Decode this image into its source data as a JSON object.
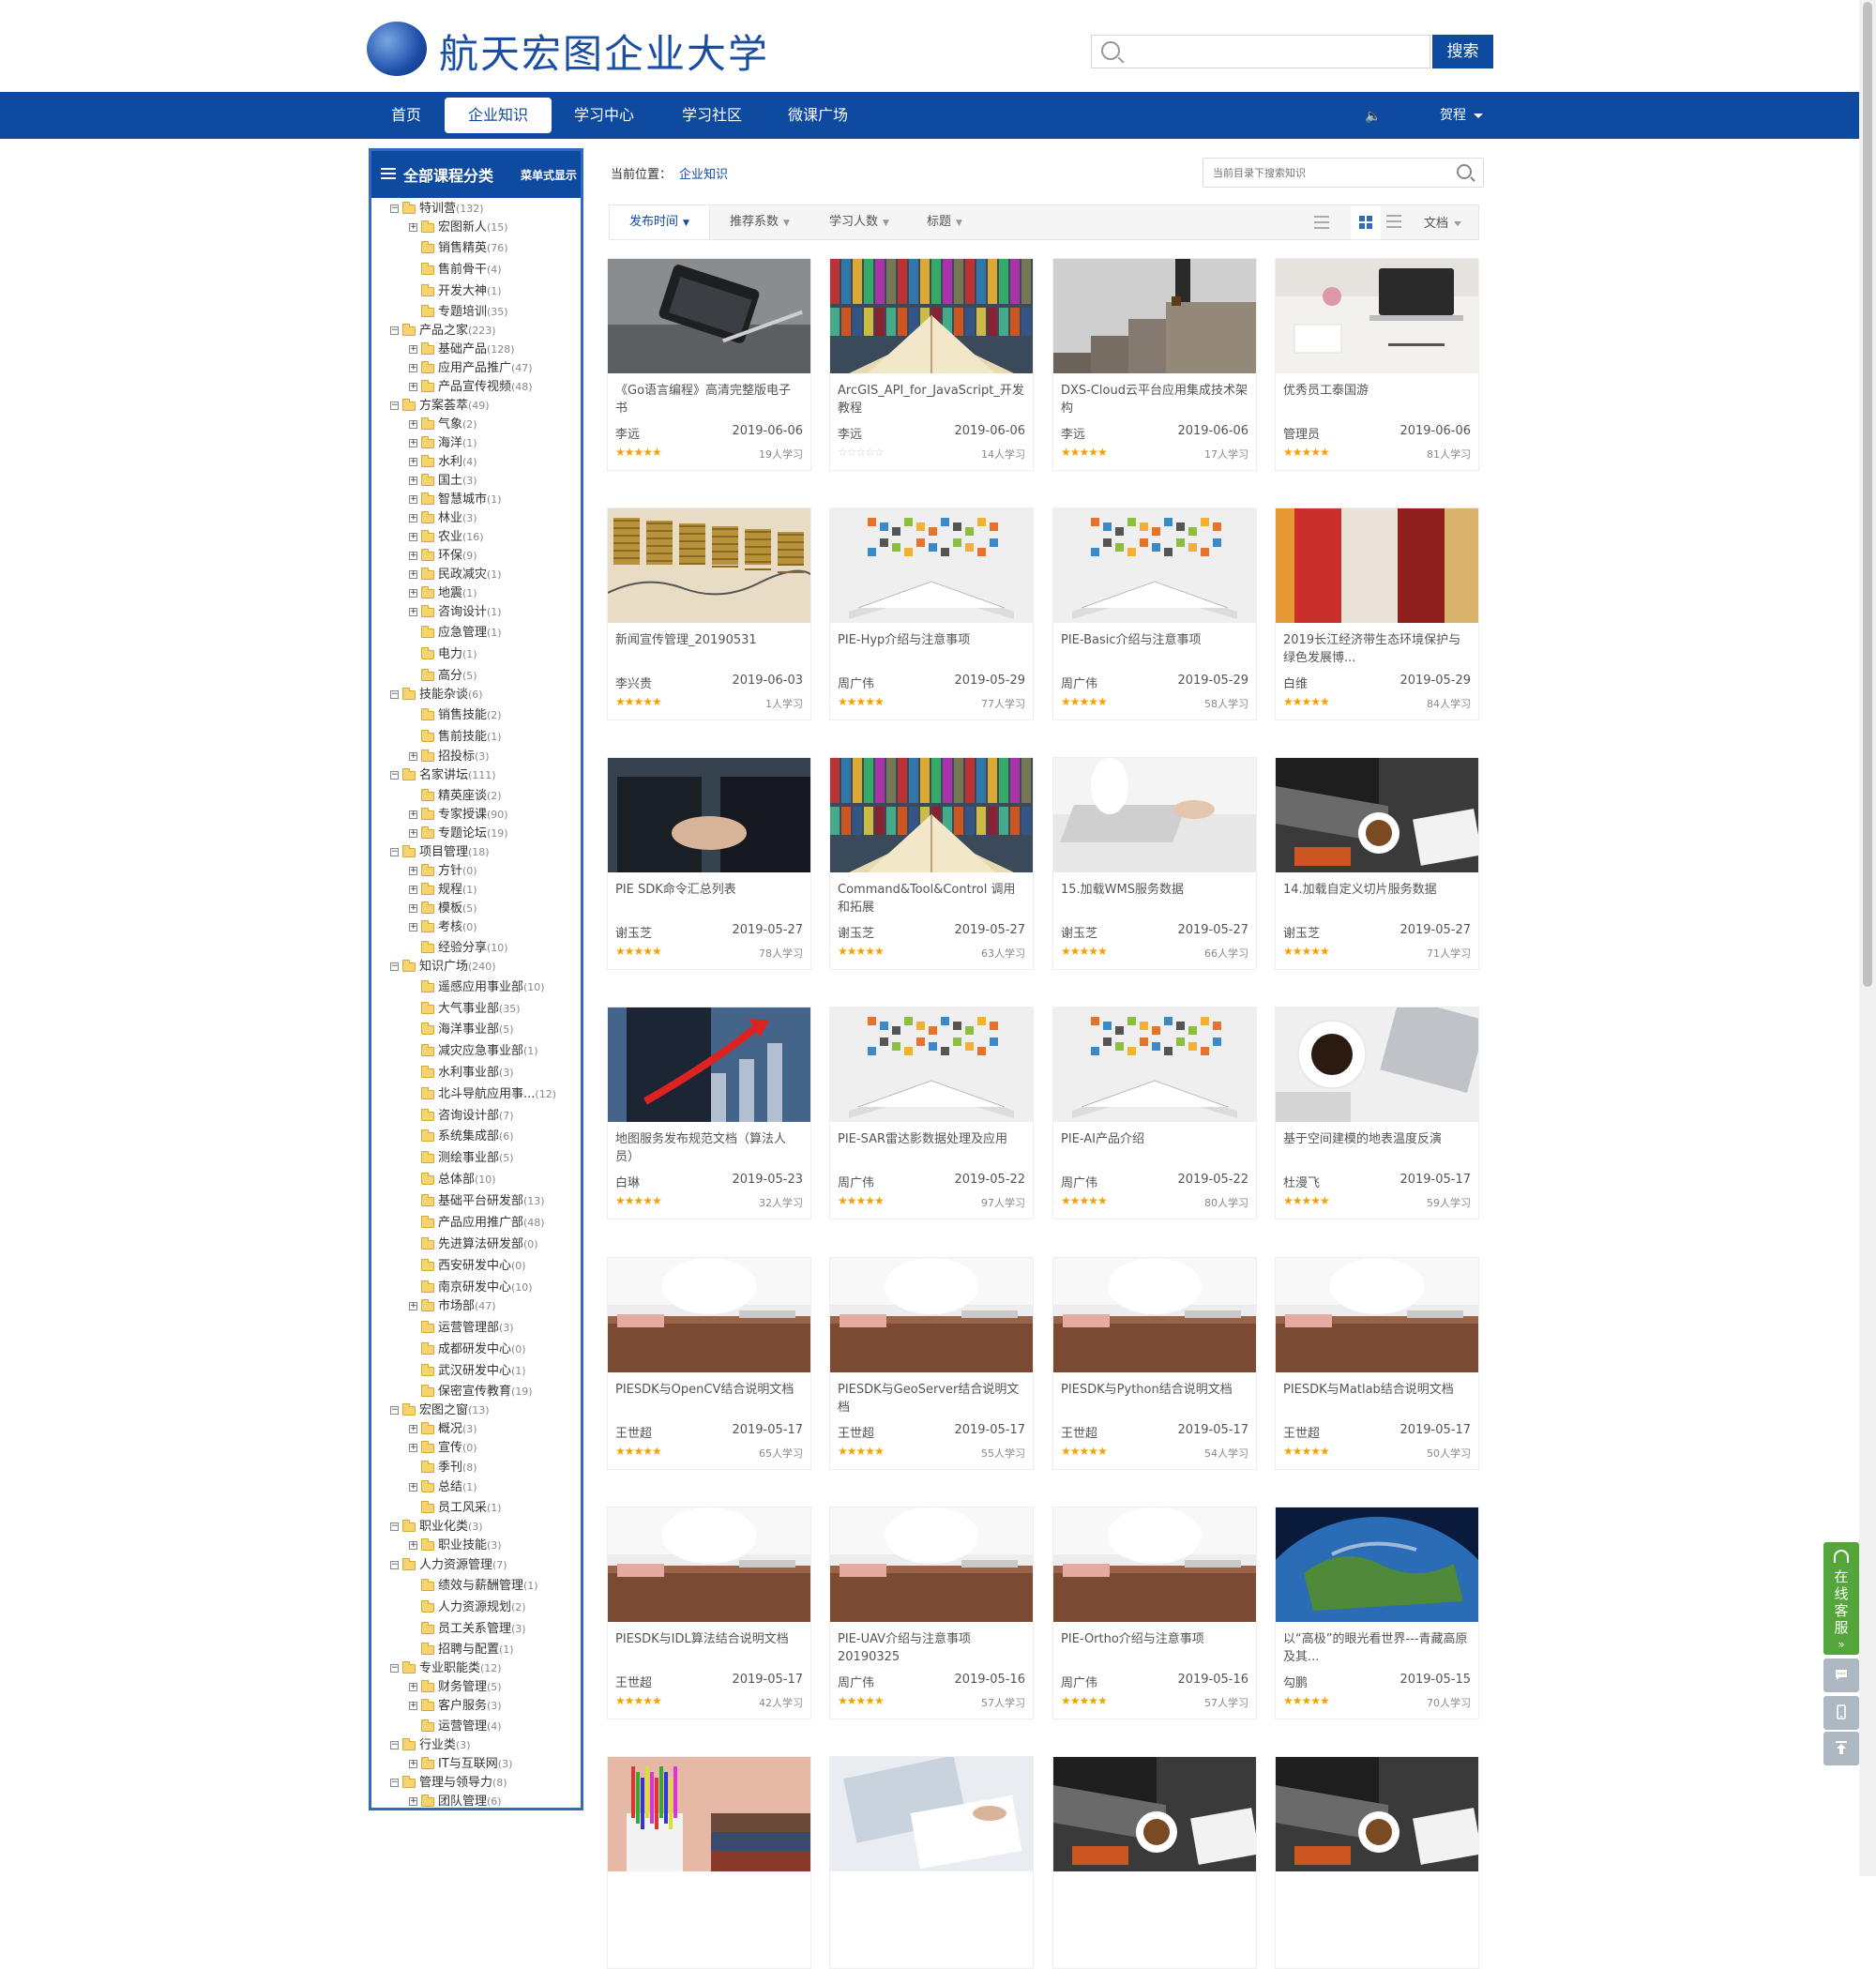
{
  "header": {
    "logo_text": "航天宏图企业大学",
    "search_placeholder": "",
    "search_button": "搜索"
  },
  "nav": {
    "items": [
      {
        "label": "首页",
        "active": false
      },
      {
        "label": "企业知识",
        "active": true
      },
      {
        "label": "学习中心",
        "active": false
      },
      {
        "label": "学习社区",
        "active": false
      },
      {
        "label": "微课广场",
        "active": false
      }
    ],
    "speaker_icon": "speaker-icon",
    "user_name": "贺程"
  },
  "sidebar": {
    "title": "全部课程分类",
    "mode_label": "菜单式显示",
    "tree": [
      {
        "level": 0,
        "toggle": "-",
        "label": "特训营",
        "count": "(132)"
      },
      {
        "level": 1,
        "toggle": "+",
        "label": "宏图新人",
        "count": "(15)"
      },
      {
        "level": 1,
        "toggle": "",
        "label": "销售精英",
        "count": "(76)"
      },
      {
        "level": 1,
        "toggle": "",
        "label": "售前骨干",
        "count": "(4)"
      },
      {
        "level": 1,
        "toggle": "",
        "label": "开发大神",
        "count": "(1)"
      },
      {
        "level": 1,
        "toggle": "",
        "label": "专题培训",
        "count": "(35)"
      },
      {
        "level": 0,
        "toggle": "-",
        "label": "产品之家",
        "count": "(223)"
      },
      {
        "level": 1,
        "toggle": "+",
        "label": "基础产品",
        "count": "(128)"
      },
      {
        "level": 1,
        "toggle": "+",
        "label": "应用产品推广",
        "count": "(47)"
      },
      {
        "level": 1,
        "toggle": "+",
        "label": "产品宣传视频",
        "count": "(48)"
      },
      {
        "level": 0,
        "toggle": "-",
        "label": "方案荟萃",
        "count": "(49)"
      },
      {
        "level": 1,
        "toggle": "+",
        "label": "气象",
        "count": "(2)"
      },
      {
        "level": 1,
        "toggle": "+",
        "label": "海洋",
        "count": "(1)"
      },
      {
        "level": 1,
        "toggle": "+",
        "label": "水利",
        "count": "(4)"
      },
      {
        "level": 1,
        "toggle": "+",
        "label": "国土",
        "count": "(3)"
      },
      {
        "level": 1,
        "toggle": "+",
        "label": "智慧城市",
        "count": "(1)"
      },
      {
        "level": 1,
        "toggle": "+",
        "label": "林业",
        "count": "(3)"
      },
      {
        "level": 1,
        "toggle": "+",
        "label": "农业",
        "count": "(16)"
      },
      {
        "level": 1,
        "toggle": "+",
        "label": "环保",
        "count": "(9)"
      },
      {
        "level": 1,
        "toggle": "+",
        "label": "民政减灾",
        "count": "(1)"
      },
      {
        "level": 1,
        "toggle": "+",
        "label": "地震",
        "count": "(1)"
      },
      {
        "level": 1,
        "toggle": "+",
        "label": "咨询设计",
        "count": "(1)"
      },
      {
        "level": 1,
        "toggle": "",
        "label": "应急管理",
        "count": "(1)"
      },
      {
        "level": 1,
        "toggle": "",
        "label": "电力",
        "count": "(1)"
      },
      {
        "level": 1,
        "toggle": "",
        "label": "高分",
        "count": "(5)"
      },
      {
        "level": 0,
        "toggle": "-",
        "label": "技能杂谈",
        "count": "(6)"
      },
      {
        "level": 1,
        "toggle": "",
        "label": "销售技能",
        "count": "(2)"
      },
      {
        "level": 1,
        "toggle": "",
        "label": "售前技能",
        "count": "(1)"
      },
      {
        "level": 1,
        "toggle": "+",
        "label": "招投标",
        "count": "(3)"
      },
      {
        "level": 0,
        "toggle": "-",
        "label": "名家讲坛",
        "count": "(111)"
      },
      {
        "level": 1,
        "toggle": "",
        "label": "精英座谈",
        "count": "(2)"
      },
      {
        "level": 1,
        "toggle": "+",
        "label": "专家授课",
        "count": "(90)"
      },
      {
        "level": 1,
        "toggle": "+",
        "label": "专题论坛",
        "count": "(19)"
      },
      {
        "level": 0,
        "toggle": "-",
        "label": "项目管理",
        "count": "(18)"
      },
      {
        "level": 1,
        "toggle": "+",
        "label": "方针",
        "count": "(0)"
      },
      {
        "level": 1,
        "toggle": "+",
        "label": "规程",
        "count": "(1)"
      },
      {
        "level": 1,
        "toggle": "+",
        "label": "模板",
        "count": "(5)"
      },
      {
        "level": 1,
        "toggle": "+",
        "label": "考核",
        "count": "(0)"
      },
      {
        "level": 1,
        "toggle": "",
        "label": "经验分享",
        "count": "(10)"
      },
      {
        "level": 0,
        "toggle": "-",
        "label": "知识广场",
        "count": "(240)"
      },
      {
        "level": 1,
        "toggle": "",
        "label": "遥感应用事业部",
        "count": "(10)"
      },
      {
        "level": 1,
        "toggle": "",
        "label": "大气事业部",
        "count": "(35)"
      },
      {
        "level": 1,
        "toggle": "",
        "label": "海洋事业部",
        "count": "(5)"
      },
      {
        "level": 1,
        "toggle": "",
        "label": "减灾应急事业部",
        "count": "(1)"
      },
      {
        "level": 1,
        "toggle": "",
        "label": "水利事业部",
        "count": "(3)"
      },
      {
        "level": 1,
        "toggle": "",
        "label": "北斗导航应用事...",
        "count": "(12)"
      },
      {
        "level": 1,
        "toggle": "",
        "label": "咨询设计部",
        "count": "(7)"
      },
      {
        "level": 1,
        "toggle": "",
        "label": "系统集成部",
        "count": "(6)"
      },
      {
        "level": 1,
        "toggle": "",
        "label": "测绘事业部",
        "count": "(5)"
      },
      {
        "level": 1,
        "toggle": "",
        "label": "总体部",
        "count": "(10)"
      },
      {
        "level": 1,
        "toggle": "",
        "label": "基础平台研发部",
        "count": "(13)"
      },
      {
        "level": 1,
        "toggle": "",
        "label": "产品应用推广部",
        "count": "(48)"
      },
      {
        "level": 1,
        "toggle": "",
        "label": "先进算法研发部",
        "count": "(0)"
      },
      {
        "level": 1,
        "toggle": "",
        "label": "西安研发中心",
        "count": "(0)"
      },
      {
        "level": 1,
        "toggle": "",
        "label": "南京研发中心",
        "count": "(10)"
      },
      {
        "level": 1,
        "toggle": "+",
        "label": "市场部",
        "count": "(47)"
      },
      {
        "level": 1,
        "toggle": "",
        "label": "运营管理部",
        "count": "(3)"
      },
      {
        "level": 1,
        "toggle": "",
        "label": "成都研发中心",
        "count": "(0)"
      },
      {
        "level": 1,
        "toggle": "",
        "label": "武汉研发中心",
        "count": "(1)"
      },
      {
        "level": 1,
        "toggle": "",
        "label": "保密宣传教育",
        "count": "(19)"
      },
      {
        "level": 0,
        "toggle": "-",
        "label": "宏图之窗",
        "count": "(13)"
      },
      {
        "level": 1,
        "toggle": "+",
        "label": "概况",
        "count": "(3)"
      },
      {
        "level": 1,
        "toggle": "+",
        "label": "宣传",
        "count": "(0)"
      },
      {
        "level": 1,
        "toggle": "",
        "label": "季刊",
        "count": "(8)"
      },
      {
        "level": 1,
        "toggle": "+",
        "label": "总结",
        "count": "(1)"
      },
      {
        "level": 1,
        "toggle": "",
        "label": "员工风采",
        "count": "(1)"
      },
      {
        "level": 0,
        "toggle": "-",
        "label": "职业化类",
        "count": "(3)"
      },
      {
        "level": 1,
        "toggle": "+",
        "label": "职业技能",
        "count": "(3)"
      },
      {
        "level": 0,
        "toggle": "-",
        "label": "人力资源管理",
        "count": "(7)"
      },
      {
        "level": 1,
        "toggle": "",
        "label": "绩效与薪酬管理",
        "count": "(1)"
      },
      {
        "level": 1,
        "toggle": "",
        "label": "人力资源规划",
        "count": "(2)"
      },
      {
        "level": 1,
        "toggle": "",
        "label": "员工关系管理",
        "count": "(3)"
      },
      {
        "level": 1,
        "toggle": "",
        "label": "招聘与配置",
        "count": "(1)"
      },
      {
        "level": 0,
        "toggle": "-",
        "label": "专业职能类",
        "count": "(12)"
      },
      {
        "level": 1,
        "toggle": "+",
        "label": "财务管理",
        "count": "(5)"
      },
      {
        "level": 1,
        "toggle": "+",
        "label": "客户服务",
        "count": "(3)"
      },
      {
        "level": 1,
        "toggle": "",
        "label": "运营管理",
        "count": "(4)"
      },
      {
        "level": 0,
        "toggle": "-",
        "label": "行业类",
        "count": "(3)"
      },
      {
        "level": 1,
        "toggle": "+",
        "label": "IT与互联网",
        "count": "(3)"
      },
      {
        "level": 0,
        "toggle": "-",
        "label": "管理与领导力",
        "count": "(8)"
      },
      {
        "level": 1,
        "toggle": "+",
        "label": "团队管理",
        "count": "(6)"
      }
    ]
  },
  "breadcrumb": {
    "label": "当前位置：",
    "link": "企业知识"
  },
  "dir_search": {
    "placeholder": "当前目录下搜索知识"
  },
  "sortbar": {
    "items": [
      {
        "label": "发布时间",
        "active": true
      },
      {
        "label": "推荐系数",
        "active": false
      },
      {
        "label": "学习人数",
        "active": false
      },
      {
        "label": "标题",
        "active": false
      }
    ],
    "doc_type": "文档"
  },
  "colors": {
    "brand": "#0e4aa0",
    "star": "#f3a200",
    "service_green": "#55a63a"
  },
  "cards": [
    {
      "title": "《Go语言编程》高清完整版电子书",
      "author": "李远",
      "date": "2019-06-06",
      "rating": 5,
      "learners": "19人学习",
      "thumb": "phone-desk"
    },
    {
      "title": "ArcGIS_API_for_JavaScript_开发教程",
      "author": "李远",
      "date": "2019-06-06",
      "rating": 0,
      "learners": "14人学习",
      "thumb": "book-library"
    },
    {
      "title": "DXS-Cloud云平台应用集成技术架构",
      "author": "李远",
      "date": "2019-06-06",
      "rating": 5,
      "learners": "17人学习",
      "thumb": "stairs"
    },
    {
      "title": "优秀员工泰国游",
      "author": "管理员",
      "date": "2019-06-06",
      "rating": 5,
      "learners": "81人学习",
      "thumb": "desk-laptop"
    },
    {
      "title": "新闻宣传管理_20190531",
      "author": "李兴贵",
      "date": "2019-06-03",
      "rating": 5,
      "learners": "1人学习",
      "thumb": "coins"
    },
    {
      "title": "PIE-Hyp介绍与注意事项",
      "author": "周广伟",
      "date": "2019-05-29",
      "rating": 5,
      "learners": "77人学习",
      "thumb": "book-icons"
    },
    {
      "title": "PIE-Basic介绍与注意事项",
      "author": "周广伟",
      "date": "2019-05-29",
      "rating": 5,
      "learners": "58人学习",
      "thumb": "book-icons"
    },
    {
      "title": "2019长江经济带生态环境保护与绿色发展博...",
      "author": "白维",
      "date": "2019-05-29",
      "rating": 5,
      "learners": "84人学习",
      "thumb": "books-red"
    },
    {
      "title": "PIE SDK命令汇总列表",
      "author": "谢玉芝",
      "date": "2019-05-27",
      "rating": 5,
      "learners": "78人学习",
      "thumb": "handshake"
    },
    {
      "title": "Command&Tool&Control 调用和拓展",
      "author": "谢玉芝",
      "date": "2019-05-27",
      "rating": 5,
      "learners": "63人学习",
      "thumb": "book-library"
    },
    {
      "title": "15.加载WMS服务数据",
      "author": "谢玉芝",
      "date": "2019-05-27",
      "rating": 5,
      "learners": "66人学习",
      "thumb": "typing"
    },
    {
      "title": "14.加载自定义切片服务数据",
      "author": "谢玉芝",
      "date": "2019-05-27",
      "rating": 5,
      "learners": "71人学习",
      "thumb": "laptop-coffee"
    },
    {
      "title": "地图服务发布规范文档（算法人员）",
      "author": "白琳",
      "date": "2019-05-23",
      "rating": 5,
      "learners": "32人学习",
      "thumb": "growth-arrow"
    },
    {
      "title": "PIE-SAR雷达影数据处理及应用",
      "author": "周广伟",
      "date": "2019-05-22",
      "rating": 5,
      "learners": "97人学习",
      "thumb": "book-icons"
    },
    {
      "title": "PIE-AI产品介绍",
      "author": "周广伟",
      "date": "2019-05-22",
      "rating": 5,
      "learners": "80人学习",
      "thumb": "book-icons"
    },
    {
      "title": "基于空间建模的地表温度反演",
      "author": "杜漫飞",
      "date": "2019-05-17",
      "rating": 5,
      "learners": "59人学习",
      "thumb": "coffee-laptop"
    },
    {
      "title": "PIESDK与OpenCV结合说明文档",
      "author": "王世超",
      "date": "2019-05-17",
      "rating": 5,
      "learners": "65人学习",
      "thumb": "office-desk"
    },
    {
      "title": "PIESDK与GeoServer结合说明文档",
      "author": "王世超",
      "date": "2019-05-17",
      "rating": 5,
      "learners": "55人学习",
      "thumb": "office-desk"
    },
    {
      "title": "PIESDK与Python结合说明文档",
      "author": "王世超",
      "date": "2019-05-17",
      "rating": 5,
      "learners": "54人学习",
      "thumb": "office-desk"
    },
    {
      "title": "PIESDK与Matlab结合说明文档",
      "author": "王世超",
      "date": "2019-05-17",
      "rating": 5,
      "learners": "50人学习",
      "thumb": "office-desk"
    },
    {
      "title": "PIESDK与IDL算法结合说明文档",
      "author": "王世超",
      "date": "2019-05-17",
      "rating": 5,
      "learners": "42人学习",
      "thumb": "office-desk"
    },
    {
      "title": "PIE-UAV介绍与注意事项20190325",
      "author": "周广伟",
      "date": "2019-05-16",
      "rating": 5,
      "learners": "57人学习",
      "thumb": "office-desk"
    },
    {
      "title": "PIE-Ortho介绍与注意事项",
      "author": "周广伟",
      "date": "2019-05-16",
      "rating": 5,
      "learners": "57人学习",
      "thumb": "office-desk"
    },
    {
      "title": "以“高极”的眼光看世界---青藏高原及其...",
      "author": "勾鹏",
      "date": "2019-05-15",
      "rating": 5,
      "learners": "70人学习",
      "thumb": "earth"
    },
    {
      "title": "",
      "author": "",
      "date": "",
      "rating": null,
      "learners": "",
      "thumb": "pencils-books"
    },
    {
      "title": "",
      "author": "",
      "date": "",
      "rating": null,
      "learners": "",
      "thumb": "laptop-papers"
    },
    {
      "title": "",
      "author": "",
      "date": "",
      "rating": null,
      "learners": "",
      "thumb": "laptop-coffee"
    },
    {
      "title": "",
      "author": "",
      "date": "",
      "rating": null,
      "learners": "",
      "thumb": "laptop-coffee"
    }
  ],
  "float_service": {
    "label": "在线客服",
    "buttons": [
      "chat-icon",
      "phone-icon",
      "back-to-top-icon"
    ]
  }
}
